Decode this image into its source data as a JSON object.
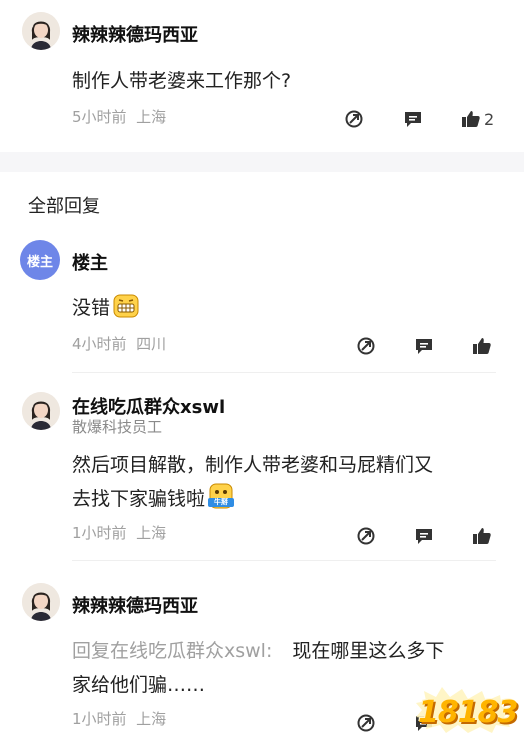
{
  "main_post": {
    "author": "辣辣辣德玛西亚",
    "content": "制作人带老婆来工作那个?",
    "time": "5小时前",
    "location": "上海",
    "like_count": "2"
  },
  "section_title": "全部回复",
  "replies": [
    {
      "badge": "楼主",
      "author": "楼主",
      "content": "没错",
      "time": "4小时前",
      "location": "四川"
    },
    {
      "author": "在线吃瓜群众xswl",
      "subtitle": "散爆科技员工",
      "content_line1": "然后项目解散，制作人带老婆和马屁精们又",
      "content_line2": "去找下家骗钱啦",
      "emoji_label": "牛掰",
      "time": "1小时前",
      "location": "上海"
    },
    {
      "author": "辣辣辣德玛西亚",
      "reply_prefix": "回复在线吃瓜群众xswl:",
      "content_line1": "现在哪里这么多下",
      "content_line2": "家给他们骗……",
      "time": "1小时前",
      "location": "上海"
    }
  ],
  "watermark": "18183",
  "colors": {
    "owner_badge": "#6e86e8",
    "meta_text": "#a0a0a0",
    "watermark": "#ffb400"
  },
  "icons": [
    "share-icon",
    "comment-icon",
    "thumbs-up-icon"
  ]
}
